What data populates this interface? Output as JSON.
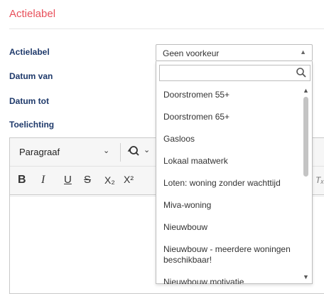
{
  "section": {
    "title": "Actielabel"
  },
  "form": {
    "labels": {
      "actielabel": "Actielabel",
      "datum_van": "Datum van",
      "datum_tot": "Datum tot",
      "toelichting": "Toelichting"
    },
    "actielabel_select": {
      "selected": "Geen voorkeur"
    }
  },
  "dropdown": {
    "search_value": "",
    "options": [
      "Doorstromen 55+",
      "Doorstromen 65+",
      "Gasloos",
      "Lokaal maatwerk",
      "Loten: woning zonder wachttijd",
      "Miva-woning",
      "Nieuwbouw",
      "Nieuwbouw - meerdere woningen beschikbaar!",
      "Nieuwbouw motivatie"
    ]
  },
  "editor": {
    "format_select": "Paragraaf",
    "icons": {
      "bold": "B",
      "italic": "I",
      "underline": "U",
      "strikethrough": "S",
      "subscript": "X₂",
      "superscript": "X²",
      "clear_format": "Tₓ"
    }
  },
  "colors": {
    "section_title": "#e8505b",
    "label": "#1f3a6b"
  }
}
